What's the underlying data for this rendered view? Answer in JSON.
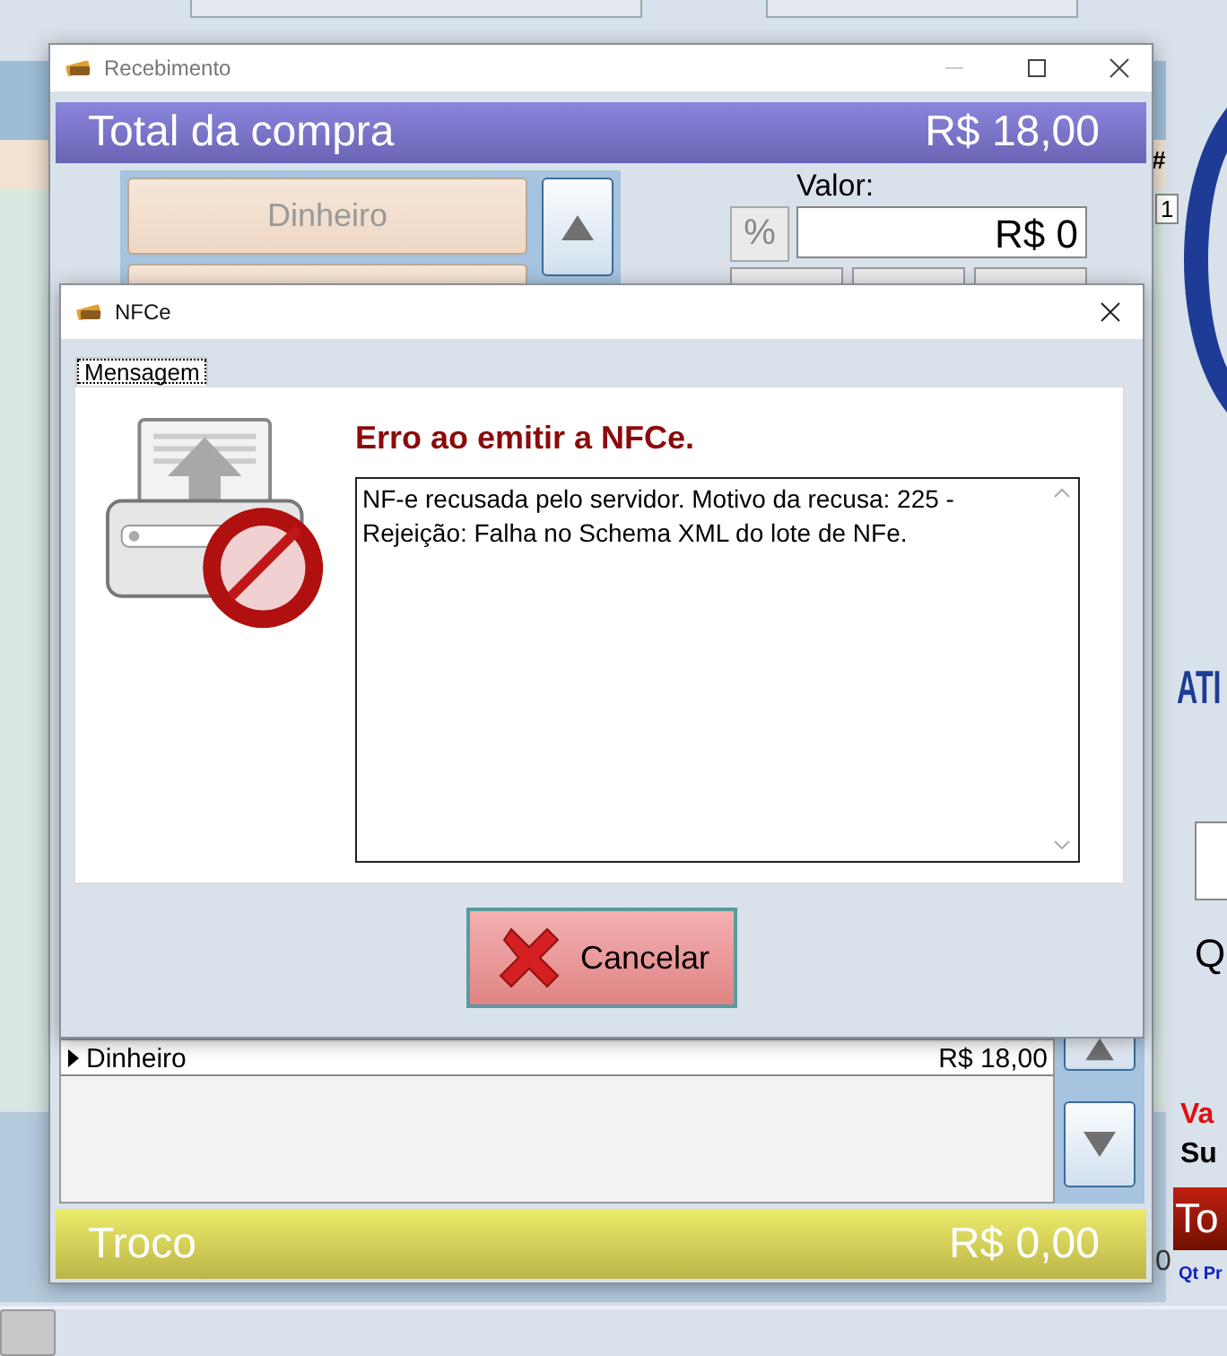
{
  "background_app": {
    "column_header": "#",
    "cell_value": "1",
    "brand_text": "ATI",
    "quantity_label": "Q",
    "value_label": "Va",
    "subtotal_label": "Su",
    "total_label": "To",
    "product_qty_label": "Qt Pr",
    "cell_digit": "0"
  },
  "payment_window": {
    "title": "Recebimento",
    "total_label": "Total da compra",
    "total_value": "R$ 18,00",
    "method_button": "Dinheiro",
    "value_label": "Valor:",
    "percent_button": "%",
    "value_field": "R$ 0",
    "payments": [
      {
        "method": "Dinheiro",
        "amount": "R$ 18,00",
        "selected": true
      }
    ],
    "change_label": "Troco",
    "change_value": "R$ 0,00"
  },
  "dialog": {
    "title": "NFCe",
    "tabs": [
      {
        "label": "Mensagem",
        "selected": true
      }
    ],
    "heading": "Erro ao emitir a NFCe.",
    "message": "NF-e recusada pelo servidor. Motivo da recusa: 225 - Rejeição: Falha no Schema XML do lote de NFe.",
    "cancel_button": "Cancelar"
  }
}
